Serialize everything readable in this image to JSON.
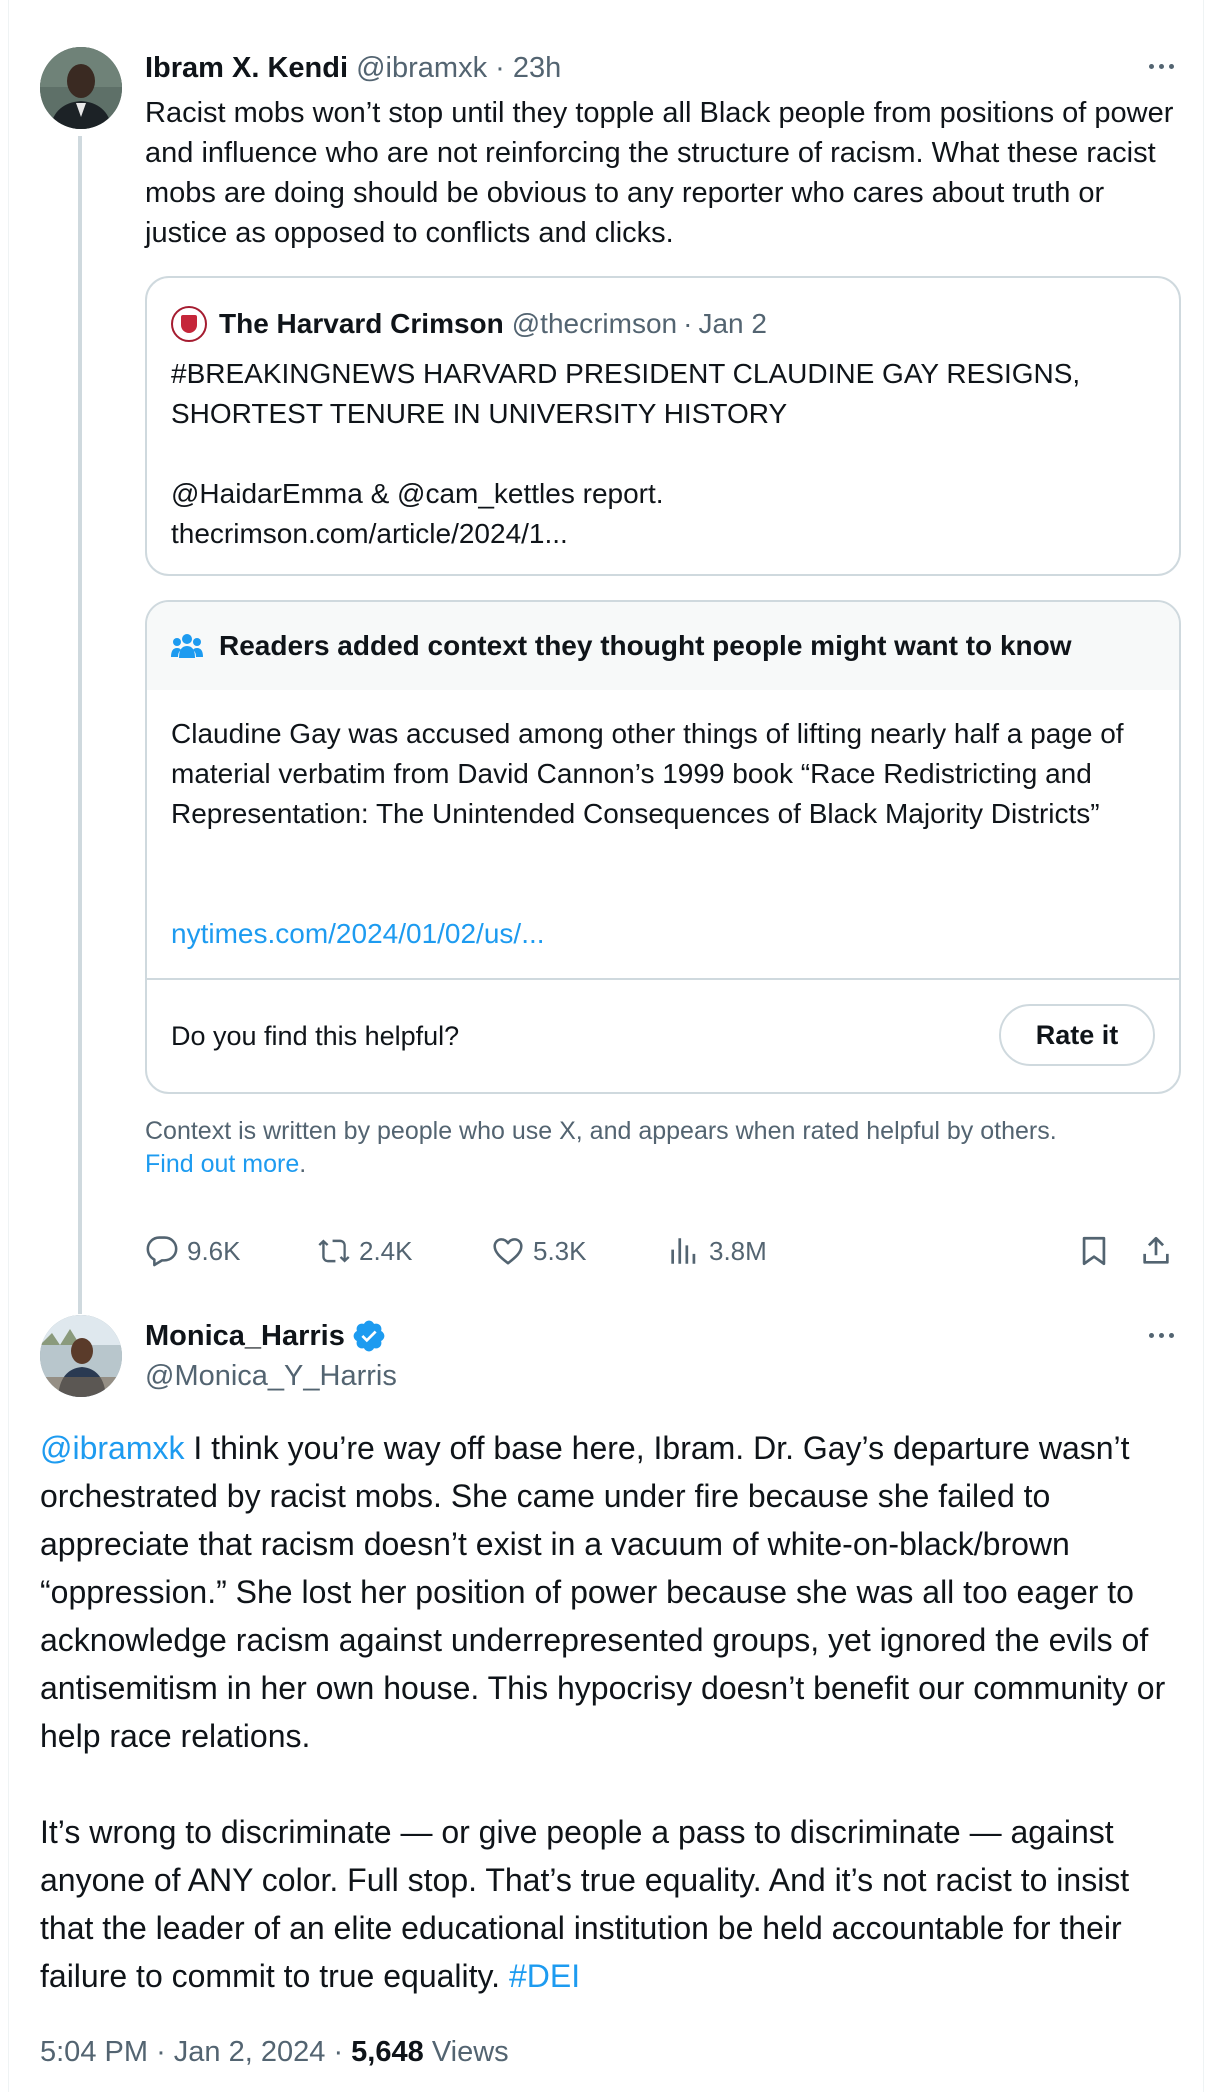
{
  "tweet1": {
    "author_name": "Ibram X. Kendi",
    "handle": "@ibramxk",
    "separator": "·",
    "time_ago": "23h",
    "text": "Racist mobs won’t stop until they topple all Black people from positions of power and influence who are not reinforcing the structure of racism. What these racist mobs are doing should be obvious to any reporter who cares about truth or justice as opposed to conflicts and clicks.",
    "quote": {
      "author_name": "The Harvard Crimson",
      "handle": "@thecrimson",
      "separator": "·",
      "date": "Jan 2",
      "text": "#BREAKINGNEWS HARVARD PRESIDENT CLAUDINE GAY RESIGNS, SHORTEST TENURE IN UNIVERSITY HISTORY\n\n@HaidarEmma & @cam_kettles report.\nthecrimson.com/article/2024/1..."
    },
    "community_note": {
      "title": "Readers added context they thought people might want to know",
      "body": "Claudine Gay was accused among other things of lifting nearly half a page of material verbatim from David Cannon’s 1999 book “Race Redistricting and Representation: The Unintended Consequences of Black Majority Districts”",
      "link": "nytimes.com/2024/01/02/us/...",
      "helpful_question": "Do you find this helpful?",
      "rate_button": "Rate it"
    },
    "context_info": "Context is written by people who use X, and appears when rated helpful by others.",
    "find_out_more": "Find out more",
    "period": ".",
    "stats": {
      "replies": "9.6K",
      "reposts": "2.4K",
      "likes": "5.3K",
      "views": "3.8M"
    }
  },
  "tweet2": {
    "author_name": "Monica_Harris",
    "handle": "@Monica_Y_Harris",
    "mention": "@ibramxk",
    "para1_rest": " I think you’re way off base here, Ibram. Dr. Gay’s departure wasn’t orchestrated by racist mobs. She came under fire because she failed to appreciate that racism doesn’t exist in a vacuum of white-on-black/brown “oppression.” She lost her position of power because she was all too eager to acknowledge racism against underrepresented groups, yet ignored the evils of antisemitism in her own house. This hypocrisy doesn’t benefit our community or help race relations.",
    "para2": "It’s wrong to discriminate — or give people a pass to discriminate — against anyone of ANY color. Full stop. That’s true equality. And it’s not racist to insist that the leader of an elite educational institution be held accountable for their failure to commit to true equality. ",
    "hashtag": "#DEI",
    "time": "5:04 PM",
    "separator": "·",
    "date": "Jan 2, 2024",
    "views_count": "5,648",
    "views_label": "Views"
  },
  "colors": {
    "accent": "#1d9bf0",
    "text": "#0f1419",
    "muted": "#536471",
    "border": "#cfd9de"
  }
}
